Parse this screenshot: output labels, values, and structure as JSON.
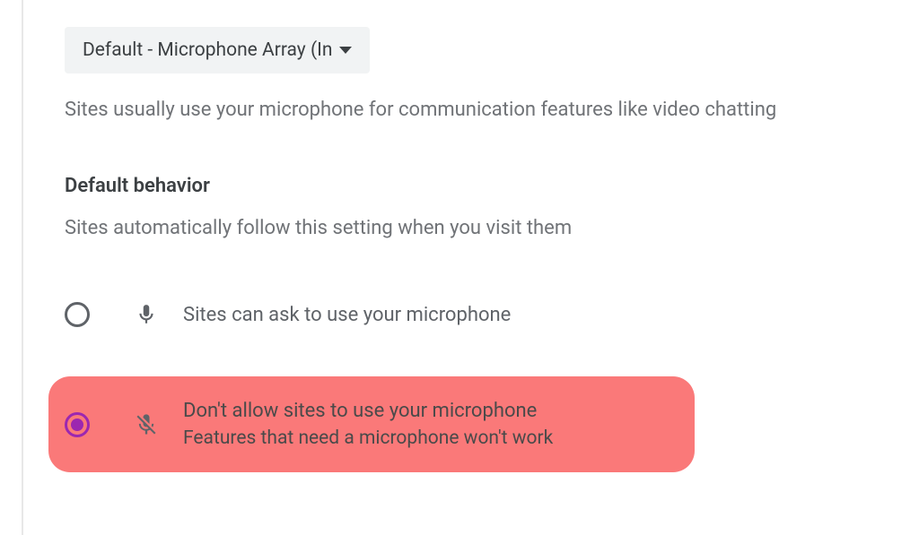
{
  "dropdown": {
    "selected_label": "Default - Microphone Array (In"
  },
  "description": "Sites usually use your microphone for communication features like video chatting",
  "section": {
    "title": "Default behavior",
    "description": "Sites automatically follow this setting when you visit them"
  },
  "options": [
    {
      "title": "Sites can ask to use your microphone",
      "subtitle": "",
      "selected": false,
      "icon": "microphone"
    },
    {
      "title": "Don't allow sites to use your microphone",
      "subtitle": "Features that need a microphone won't work",
      "selected": true,
      "icon": "microphone-off"
    }
  ]
}
